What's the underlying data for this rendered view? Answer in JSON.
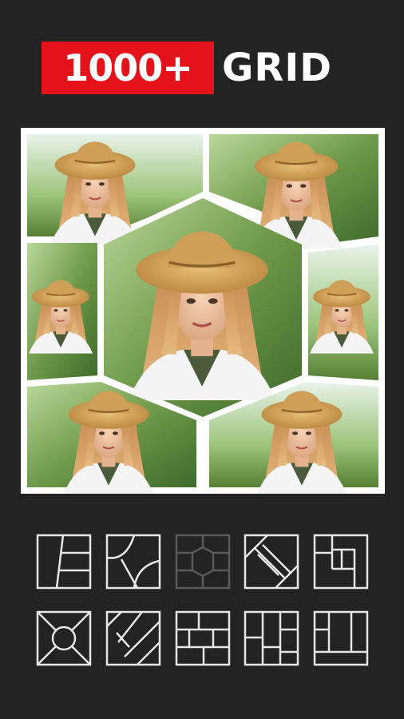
{
  "headline": {
    "badge_text": "1000+",
    "word": "GRID",
    "badge_color": "#e3121b"
  },
  "collage": {
    "photo_subject": "woman-in-straw-hat",
    "cells": 7
  },
  "templates": {
    "count": 10,
    "selected_index": 2,
    "line_color": "#e6e6e6",
    "selected_line_color": "#5a5a5a",
    "items": [
      "layout-slanted-thirds-icon",
      "layout-curved-quadrants-icon",
      "layout-hexagon-icon",
      "layout-diamond-icon",
      "layout-spiral-blocks-icon",
      "layout-circle-cross-icon",
      "layout-slanted-stripes-icon",
      "layout-brick-icon",
      "layout-columns-icon",
      "layout-corner-blocks-icon"
    ]
  }
}
